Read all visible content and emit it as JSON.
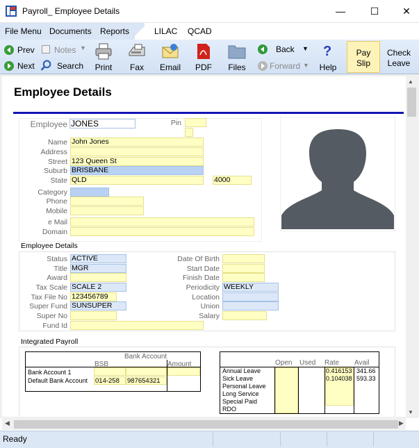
{
  "window": {
    "title": "Payroll_ Employee Details",
    "minimize": "—",
    "maximize": "☐",
    "close": "✕"
  },
  "menu": {
    "items": [
      "File Menu",
      "Documents",
      "Reports",
      "LILAC",
      "QCAD"
    ]
  },
  "toolbar": {
    "prev": "Prev",
    "next": "Next",
    "notes": "Notes",
    "search": "Search",
    "print": "Print",
    "fax": "Fax",
    "email": "Email",
    "pdf": "PDF",
    "files": "Files",
    "back": "Back",
    "forward": "Forward",
    "help": "Help",
    "payslip_line1": "Pay",
    "payslip_line2": "Slip",
    "checkleave_line1": "Check",
    "checkleave_line2": "Leave"
  },
  "page": {
    "heading": "Employee  Details"
  },
  "employee": {
    "employee_label": "Employee",
    "employee_value": "JONES",
    "pin_label": "Pin",
    "pin_value": "",
    "name_label": "Name",
    "name_value": "John Jones",
    "address_label": "Address",
    "address_value": "",
    "street_label": "Street",
    "street_value": "123 Queen St",
    "suburb_label": "Suburb",
    "suburb_value": "BRISBANE",
    "state_label": "State",
    "state_value": "QLD",
    "postcode_value": "4000",
    "category_label": "Category",
    "category_value": "",
    "phone_label": "Phone",
    "phone_value": "",
    "mobile_label": "Mobile",
    "mobile_value": "",
    "email_label": "e Mail",
    "email_value": "",
    "domain_label": "Domain",
    "domain_value": ""
  },
  "details": {
    "section_title": "Employee Details",
    "status_label": "Status",
    "status_value": "ACTIVE",
    "title_label": "Title",
    "title_value": "MGR",
    "award_label": "Award",
    "award_value": "",
    "taxscale_label": "Tax Scale",
    "taxscale_value": "SCALE 2",
    "taxfile_label": "Tax File No",
    "taxfile_value": "123456789",
    "superfund_label": "Super Fund",
    "superfund_value": "SUNSUPER",
    "superno_label": "Super No",
    "superno_value": "",
    "fundid_label": "Fund Id",
    "fundid_value": "",
    "dob_label": "Date Of Birth",
    "dob_value": "",
    "startdate_label": "Start Date",
    "startdate_value": "",
    "finishdate_label": "Finish Date",
    "finishdate_value": "",
    "periodicity_label": "Periodicity",
    "periodicity_value": "WEEKLY",
    "location_label": "Location",
    "location_value": "",
    "union_label": "Union",
    "union_value": "",
    "salary_label": "Salary",
    "salary_value": ""
  },
  "payroll": {
    "section_title": "Integrated Payroll",
    "bank": {
      "header": "Bank Account",
      "bsb_header": "BSB",
      "amount_header": "Amount",
      "row1_label": "Bank Account 1",
      "row2_label": "Default Bank Account",
      "bsb_value": "014-258",
      "account_value": "987654321"
    },
    "leave": {
      "open_header": "Open",
      "used_header": "Used",
      "rate_header": "Rate",
      "avail_header": "Avail",
      "rows": [
        "Annual Leave",
        "Sick Leave",
        "Personal Leave",
        "Long Service",
        "Special Paid",
        "RDO"
      ],
      "annual_rate": "0.416153",
      "annual_avail": "341.66",
      "sick_rate": "0.104038",
      "sick_avail": "593.33"
    }
  },
  "status": {
    "text": "Ready"
  },
  "colors": {
    "accent_line": "#1414b4",
    "field_yellow": "#ffffc4",
    "field_blue": "#dce8f8",
    "payslip_highlight": "#fdf3b8"
  }
}
